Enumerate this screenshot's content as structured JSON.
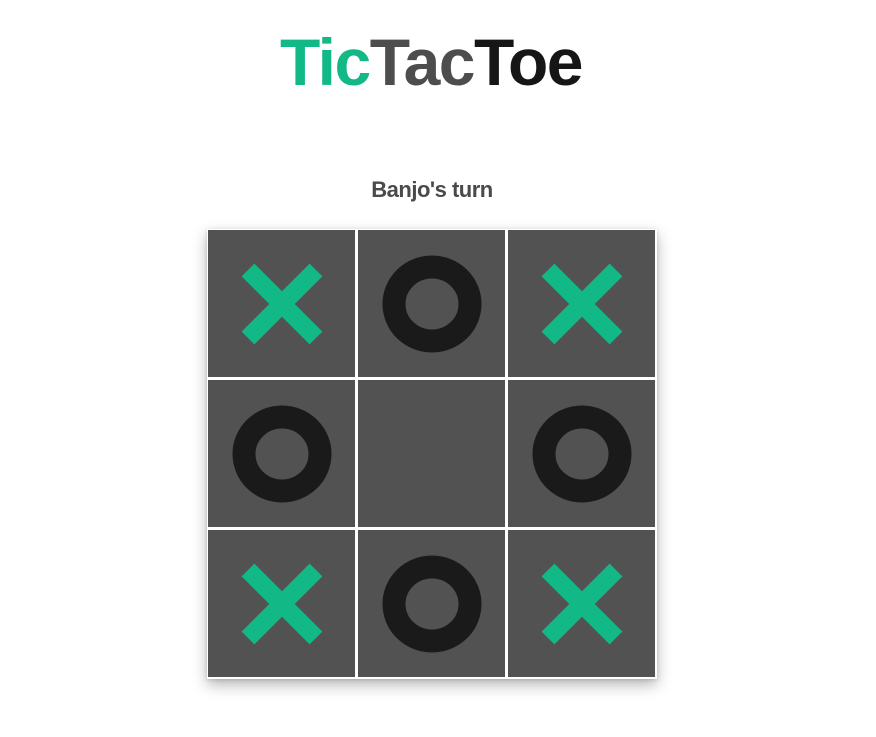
{
  "title": {
    "part1": "Tic",
    "part2": "Tac",
    "part3": "Toe"
  },
  "status": "Banjo's turn",
  "colors": {
    "x_mark": "#12b886",
    "o_mark": "#1a1a1a",
    "cell_background": "#525252",
    "title_tic": "#12b886",
    "title_tac": "#4d4d4d",
    "title_toe": "#161616"
  },
  "board": {
    "cells": [
      "X",
      "O",
      "X",
      "O",
      "",
      "O",
      "X",
      "O",
      "X"
    ]
  }
}
